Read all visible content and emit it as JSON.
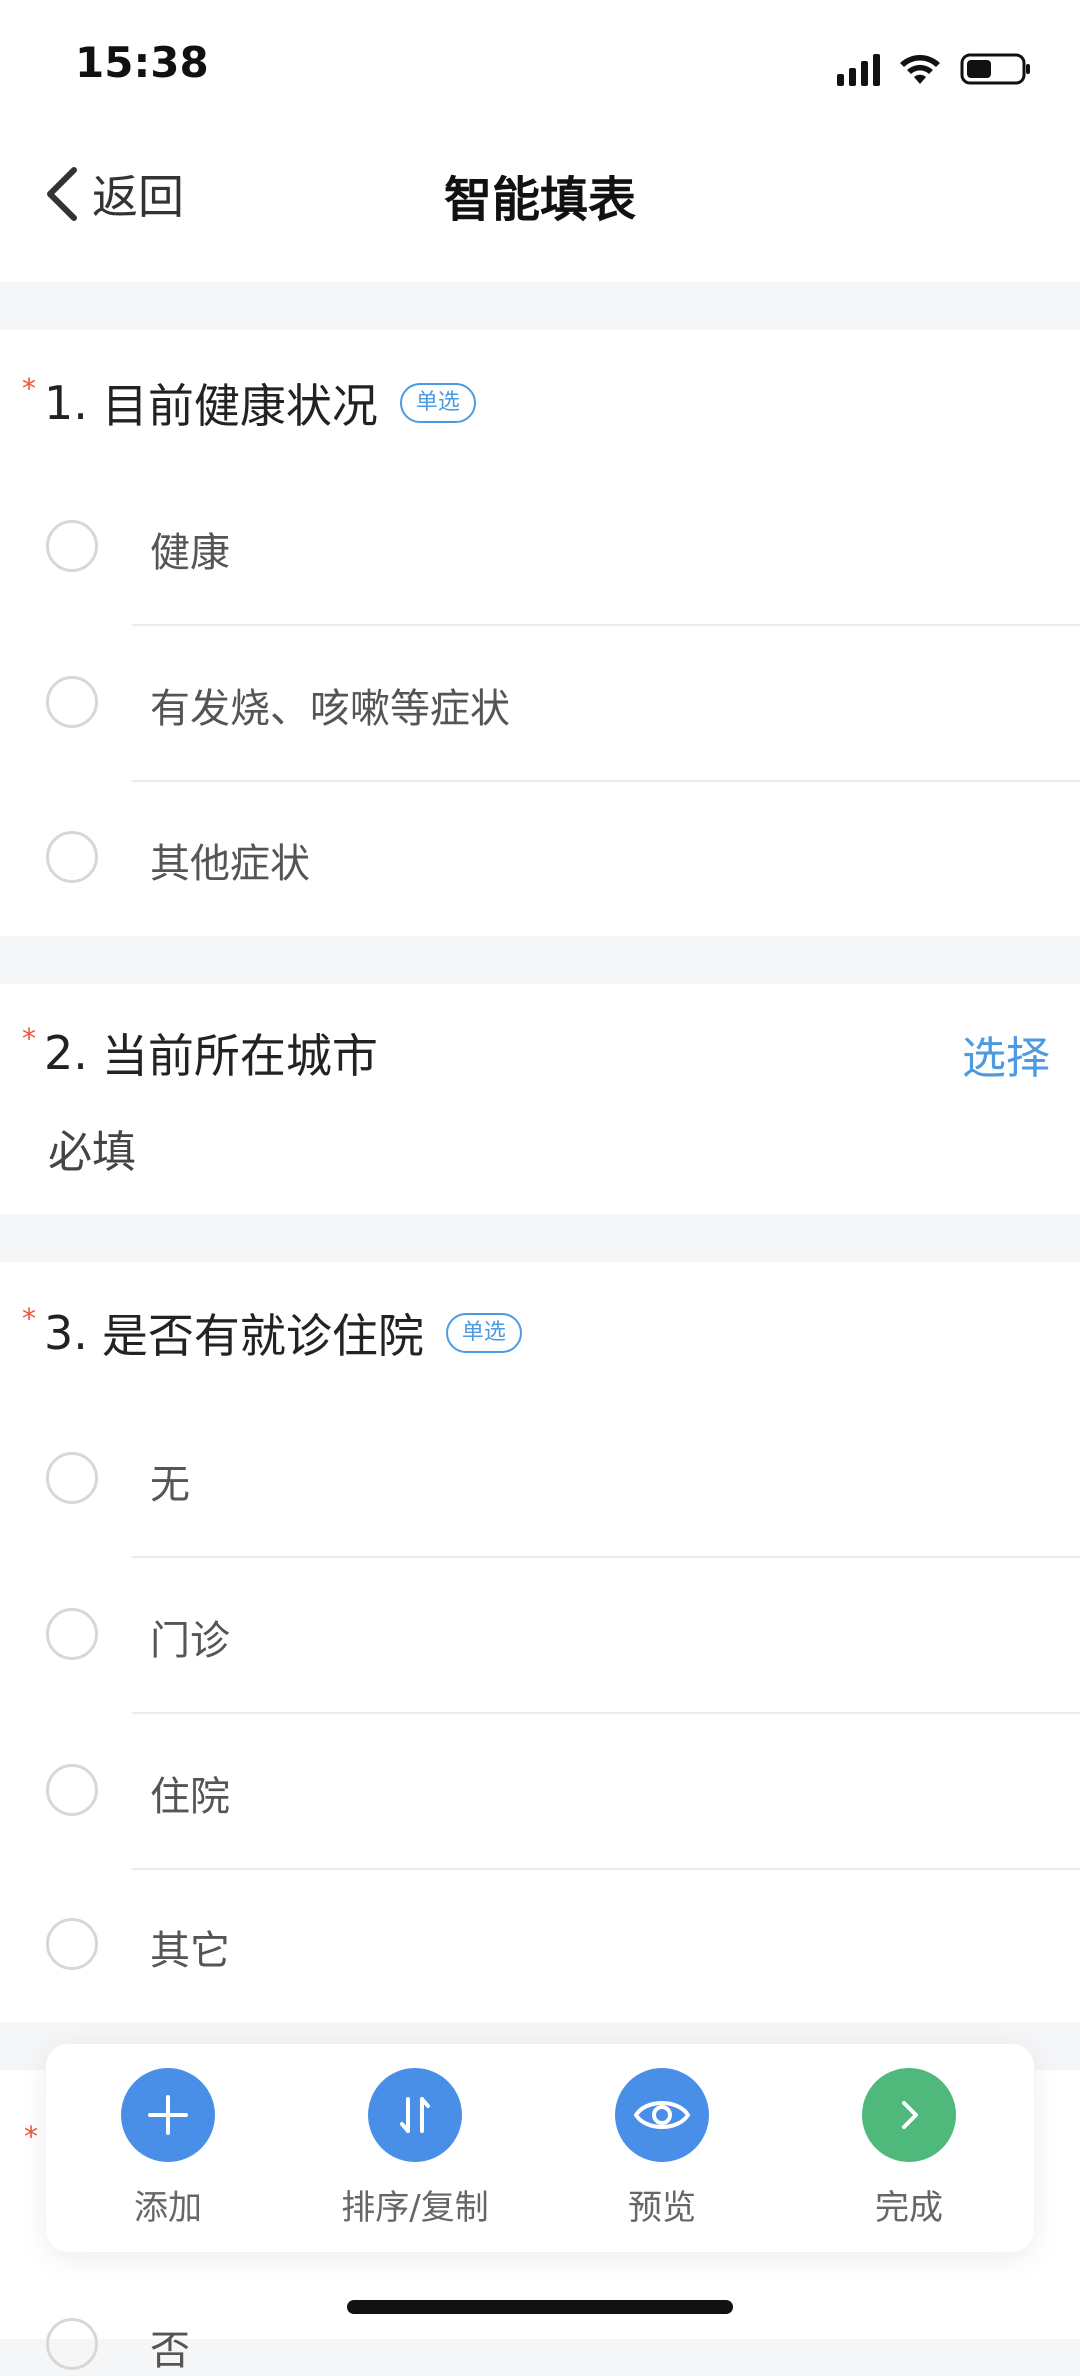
{
  "status_bar": {
    "time": "15:38"
  },
  "nav": {
    "back_label": "返回",
    "title": "智能填表"
  },
  "questions": [
    {
      "number": "1.",
      "title": "目前健康状况",
      "badge": "单选",
      "options": [
        "健康",
        "有发烧、咳嗽等症状",
        "其他症状"
      ]
    },
    {
      "number": "2.",
      "title": "当前所在城市",
      "action": "选择",
      "value": "必填"
    },
    {
      "number": "3.",
      "title": "是否有就诊住院",
      "badge": "单选",
      "options": [
        "无",
        "门诊",
        "住院",
        "其它"
      ]
    }
  ],
  "required_mark": "*",
  "peek_option": "否",
  "toolbar": [
    {
      "label": "添加",
      "icon": "plus-icon",
      "color": "#4a8fe7"
    },
    {
      "label": "排序/复制",
      "icon": "sort-icon",
      "color": "#4a8fe7"
    },
    {
      "label": "预览",
      "icon": "eye-icon",
      "color": "#4a8fe7"
    },
    {
      "label": "完成",
      "icon": "chevron-right-icon",
      "color": "#4fb97b"
    }
  ]
}
